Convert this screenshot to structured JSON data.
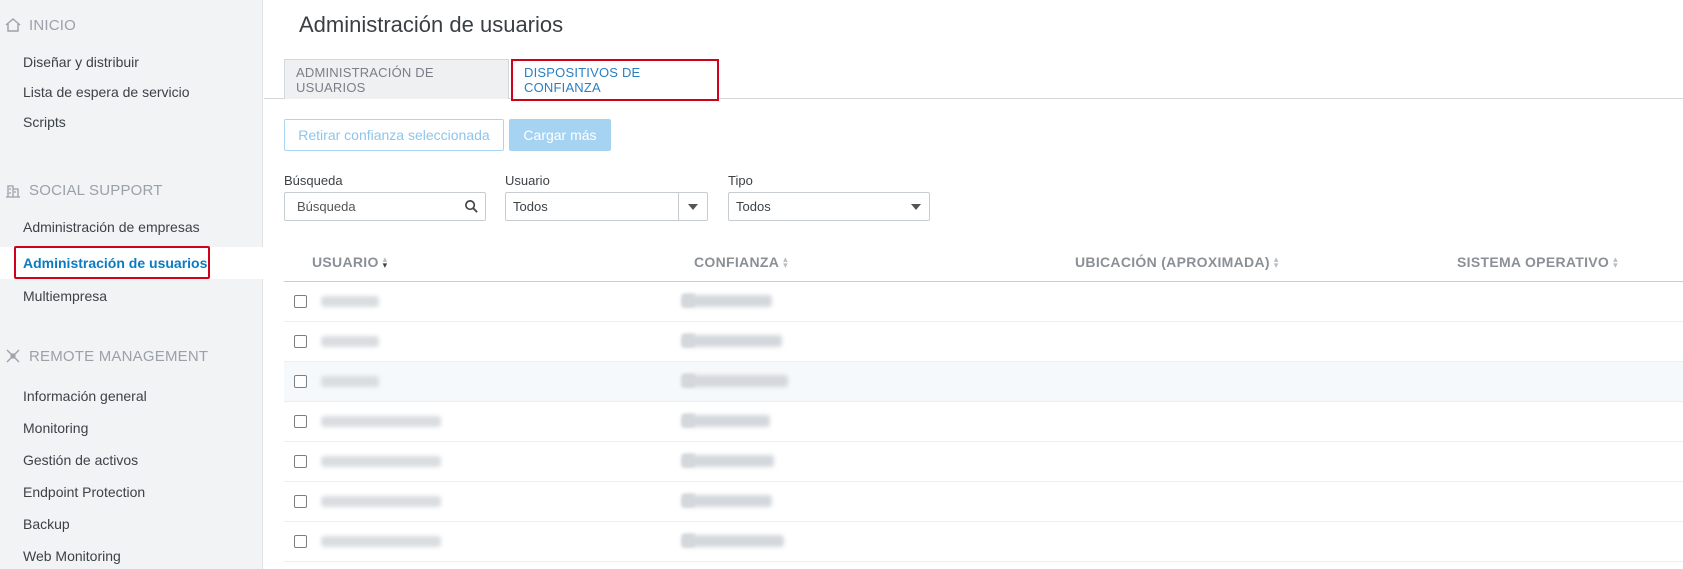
{
  "sidebar": {
    "sections": [
      {
        "title": "INICIO",
        "icon": "home-icon",
        "items": [
          "Diseñar y distribuir",
          "Lista de espera de servicio",
          "Scripts"
        ]
      },
      {
        "title": "SOCIAL SUPPORT",
        "icon": "building-icon",
        "items": [
          "Administración de empresas",
          "Administración de usuarios",
          "Multiempresa"
        ]
      },
      {
        "title": "REMOTE MANAGEMENT",
        "icon": "network-icon",
        "items": [
          "Información general",
          "Monitoring",
          "Gestión de activos",
          "Endpoint Protection",
          "Backup",
          "Web Monitoring"
        ]
      }
    ],
    "active_item": "Administración de usuarios"
  },
  "main": {
    "title": "Administración de usuarios",
    "tabs": [
      {
        "label": "ADMINISTRACIÓN DE USUARIOS",
        "active": false
      },
      {
        "label": "DISPOSITIVOS DE CONFIANZA",
        "active": true
      }
    ],
    "buttons": {
      "retirar": "Retirar confianza seleccionada",
      "cargar": "Cargar más"
    },
    "filters": {
      "busqueda_label": "Búsqueda",
      "busqueda_placeholder": "Búsqueda",
      "usuario_label": "Usuario",
      "usuario_value": "Todos",
      "tipo_label": "Tipo",
      "tipo_value": "Todos"
    },
    "table": {
      "columns": [
        "USUARIO",
        "CONFIANZA",
        "UBICACIÓN (APROXIMADA)",
        "SISTEMA OPERATIVO"
      ],
      "rows_count_note": "7 rows with blurred values",
      "row_count": 7
    }
  },
  "colors": {
    "accent": "#0b7bc1",
    "highlight_box": "#d0021b",
    "sidebar_bg": "#f1f3f5",
    "button_light": "#a6d3f2"
  }
}
